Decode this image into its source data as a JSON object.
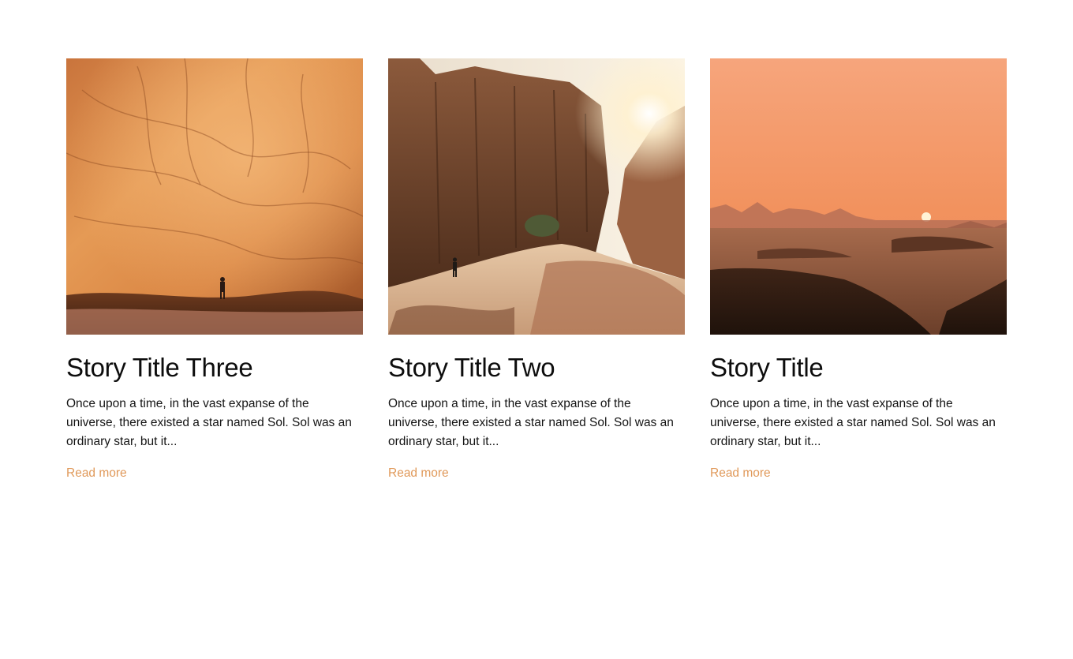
{
  "stories": [
    {
      "title": "Story Title Three",
      "excerpt": "Once upon a time, in the vast expanse of the universe, there existed a star named Sol. Sol was an ordinary star, but it...",
      "link_label": "Read more"
    },
    {
      "title": "Story Title Two",
      "excerpt": "Once upon a time, in the vast expanse of the universe, there existed a star named Sol. Sol was an ordinary star, but it...",
      "link_label": "Read more"
    },
    {
      "title": "Story Title",
      "excerpt": "Once upon a time, in the vast expanse of the universe, there existed a star named Sol. Sol was an ordinary star, but it...",
      "link_label": "Read more"
    }
  ],
  "colors": {
    "link": "#e0995a",
    "text": "#141414",
    "background": "#ffffff"
  }
}
